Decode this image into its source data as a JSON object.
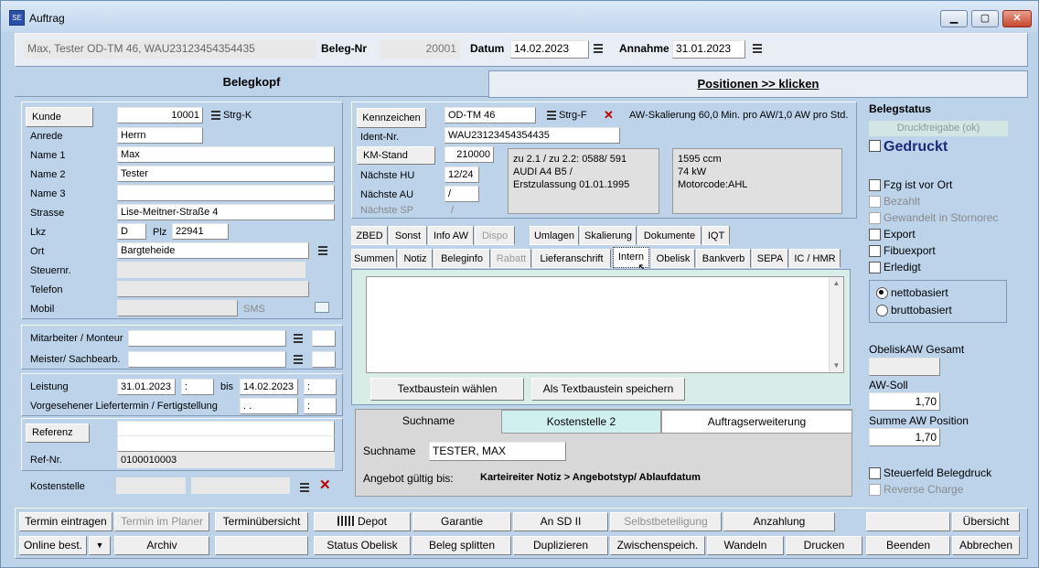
{
  "window": {
    "title": "Auftrag",
    "app_icon_label": "SE"
  },
  "header": {
    "summary": "Max, Tester OD-TM 46, WAU23123454354435",
    "beleg_label": "Beleg-Nr",
    "beleg_value": "20001",
    "datum_label": "Datum",
    "datum_value": "14.02.2023",
    "annahme_label": "Annahme",
    "annahme_value": "31.01.2023"
  },
  "top_tabs": {
    "left": "Belegkopf",
    "right": "Positionen >> klicken"
  },
  "kunde": {
    "kunde_btn": "Kunde",
    "kunde_value": "10001",
    "strgk": "Strg-K",
    "anrede_label": "Anrede",
    "anrede_value": "Herrn",
    "name1_label": "Name 1",
    "name1_value": "Max",
    "name2_label": "Name 2",
    "name2_value": "Tester",
    "name3_label": "Name 3",
    "name3_value": "",
    "strasse_label": "Strasse",
    "strasse_value": "Lise-Meitner-Straße 4",
    "lkz_label": "Lkz",
    "lkz_value": "D",
    "plz_label": "Plz",
    "plz_value": "22941",
    "ort_label": "Ort",
    "ort_value": "Bargteheide",
    "steuer_label": "Steuernr.",
    "telefon_label": "Telefon",
    "mobil_label": "Mobil",
    "sms_label": "SMS"
  },
  "mitarbeiter": {
    "label1": "Mitarbeiter / Monteur",
    "label2": "Meister/ Sachbearb."
  },
  "leistung": {
    "label": "Leistung",
    "from": "31.01.2023",
    "from_time": ":",
    "bis": "bis",
    "to": "14.02.2023",
    "to_time": ":",
    "liefer_label": "Vorgesehener Liefertermin / Fertigstellung",
    "liefer_date": ". .",
    "liefer_time": ":"
  },
  "referenz": {
    "btn": "Referenz",
    "refnr_label": "Ref-Nr.",
    "refnr_value": "0100010003"
  },
  "kostenstelle": {
    "label": "Kostenstelle"
  },
  "fahrzeug": {
    "kennzeichen_btn": "Kennzeichen",
    "kennzeichen_value": "OD-TM 46",
    "strgf": "Strg-F",
    "aw_text": "AW-Skalierung  60,0 Min. pro AW/1,0 AW pro Std.",
    "ident_label": "Ident-Nr.",
    "ident_value": "WAU23123454354435",
    "km_btn": "KM-Stand",
    "km_value": "210000",
    "hu_label": "Nächste HU",
    "hu_value": "12/24",
    "au_label": "Nächste AU",
    "au_value": "/",
    "sp_label": "Nächste SP",
    "sp_value": "/",
    "info1_l1": "zu 2.1 / zu 2.2: 0588/ 591",
    "info1_l2": "AUDI A4 B5 /",
    "info1_l3": "Erstzulassung 01.01.1995",
    "info2_l1": "1595 ccm",
    "info2_l2": "74 kW",
    "info2_l3": "Motorcode:AHL"
  },
  "tabs_row1": [
    "ZBED",
    "Sonst",
    "Info AW",
    "Dispo",
    "Umlagen",
    "Skalierung",
    "Dokumente",
    "IQT"
  ],
  "tabs_row2": [
    "Summen",
    "Notiz",
    "Beleginfo",
    "Rabatt",
    "Lieferanschrift",
    "Intern",
    "Obelisk",
    "Bankverb",
    "SEPA",
    "IC / HMR"
  ],
  "textbaustein": {
    "waehlen": "Textbaustein wählen",
    "speichern": "Als Textbaustein speichern"
  },
  "search_tabs": [
    "Suchname",
    "Kostenstelle 2",
    "Auftragserweiterung"
  ],
  "search": {
    "label": "Suchname",
    "value": "TESTER, MAX",
    "angebot_label": "Angebot gültig bis:",
    "angebot_hint": "Karteireiter Notiz > Angebotstyp/ Ablaufdatum"
  },
  "belegstatus": {
    "title": "Belegstatus",
    "druck_status": "Druckfreigabe (ok)",
    "gedruckt": "Gedruckt",
    "checks": [
      "Fzg ist vor Ort",
      "Bezahlt",
      "Gewandelt in Stornorec",
      "Export",
      "Fibuexport",
      "Erledigt"
    ],
    "netto": "nettobasiert",
    "brutto": "bruttobasiert",
    "obelisk_label": "ObeliskAW Gesamt",
    "awsoll_label": "AW-Soll",
    "awsoll_value": "1,70",
    "summe_label": "Summe AW Position",
    "summe_value": "1,70",
    "steuerfeld": "Steuerfeld Belegdruck",
    "reverse": "Reverse Charge"
  },
  "bottom_row1": [
    "Termin eintragen",
    "Termin im Planer",
    "Terminübersicht",
    "Depot",
    "Garantie",
    "An SD II",
    "Selbstbeteiligung",
    "Anzahlung",
    "",
    "Übersicht"
  ],
  "bottom_row2": [
    "Online best.",
    "Archiv",
    "",
    "Status Obelisk",
    "Beleg splitten",
    "Duplizieren",
    "Zwischenspeich.",
    "Wandeln",
    "Drucken",
    "Beenden",
    "Abbrechen"
  ]
}
